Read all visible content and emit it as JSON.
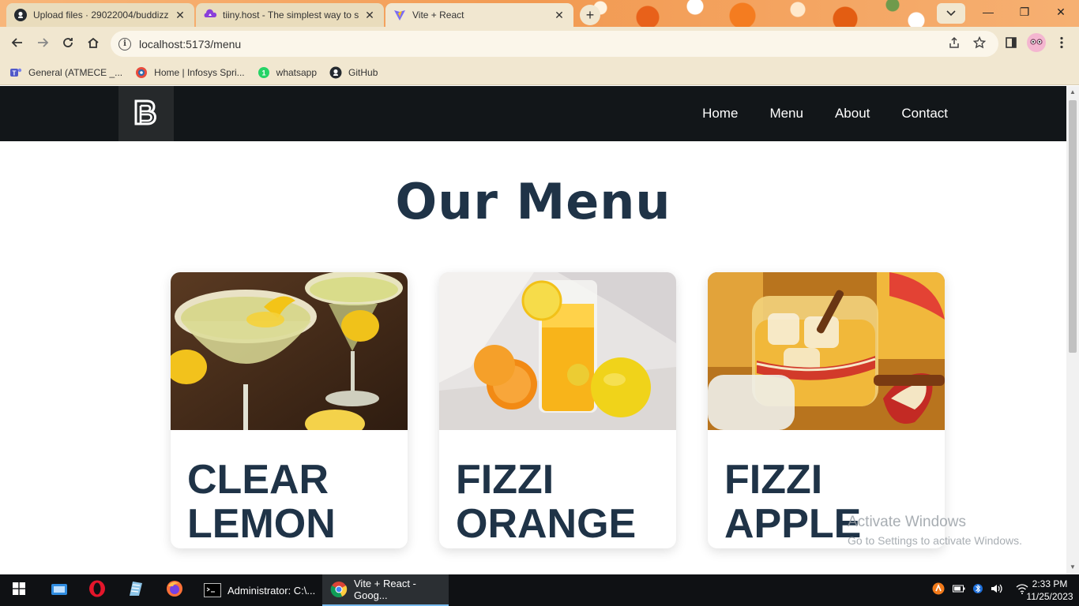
{
  "browser": {
    "tabs": [
      {
        "title": "Upload files · 29022004/buddizz",
        "icon": "github-icon",
        "active": false
      },
      {
        "title": "tiiny.host - The simplest way to s",
        "icon": "tiiny-host-icon",
        "active": false
      },
      {
        "title": "Vite + React",
        "icon": "vite-icon",
        "active": true
      }
    ],
    "new_tab_symbol": "+",
    "url": "localhost:5173/menu",
    "bookmarks": [
      {
        "label": "General (ATMECE _...",
        "icon": "teams-icon"
      },
      {
        "label": "Home | Infosys Spri...",
        "icon": "infosys-icon"
      },
      {
        "label": "whatsapp",
        "icon": "whatsapp-icon"
      },
      {
        "label": "GitHub",
        "icon": "github-icon"
      }
    ],
    "window_controls": {
      "minimize": "—",
      "restore": "❐",
      "close": "✕"
    }
  },
  "site": {
    "logo": "B",
    "nav": [
      "Home",
      "Menu",
      "About",
      "Contact"
    ],
    "heading": "Our Menu",
    "cards": [
      {
        "name_line1": "CLEAR",
        "name_line2": "LEMON",
        "image": "lemon-cocktail-image"
      },
      {
        "name_line1": "FIZZI",
        "name_line2": "ORANGE",
        "image": "orange-juice-image"
      },
      {
        "name_line1": "FIZZI",
        "name_line2": "APPLE",
        "image": "apple-cider-image"
      }
    ]
  },
  "watermark": {
    "line1": "Activate Windows",
    "line2": "Go to Settings to activate Windows."
  },
  "taskbar": {
    "apps": [
      {
        "label": "Administrator:  C:\\...",
        "icon": "cmd-icon",
        "active": false
      },
      {
        "label": "Vite + React - Goog...",
        "icon": "chrome-icon",
        "active": true
      }
    ],
    "time": "2:33 PM",
    "date": "11/25/2023"
  },
  "colors": {
    "nav_bg": "#121619",
    "heading": "#1f3347",
    "chrome_toolbar": "#f1e7d0",
    "taskbar": "#0f1114"
  }
}
